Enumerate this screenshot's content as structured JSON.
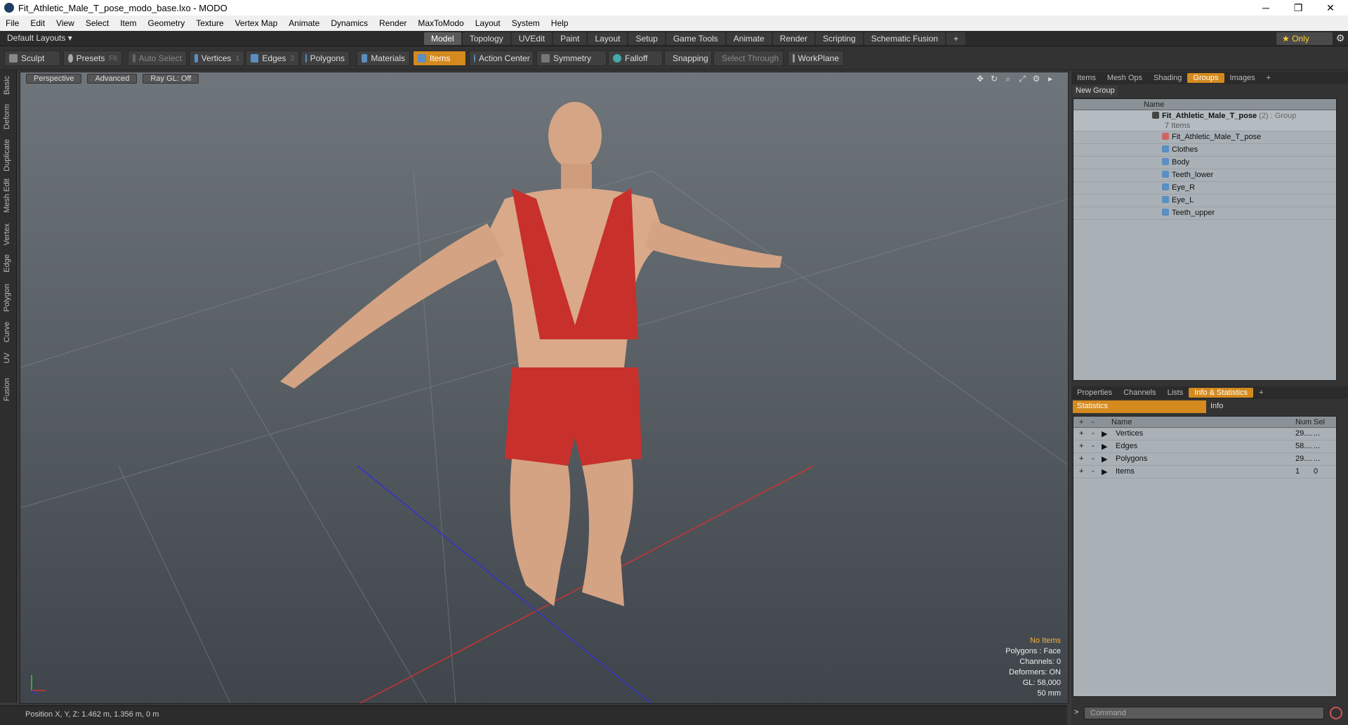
{
  "window": {
    "title": "Fit_Athletic_Male_T_pose_modo_base.lxo - MODO",
    "min": "─",
    "max": "❐",
    "close": "✕"
  },
  "menu": [
    "File",
    "Edit",
    "View",
    "Select",
    "Item",
    "Geometry",
    "Texture",
    "Vertex Map",
    "Animate",
    "Dynamics",
    "Render",
    "MaxToModo",
    "Layout",
    "System",
    "Help"
  ],
  "layouts_label": "Default Layouts ▾",
  "mode_tabs": [
    "Model",
    "Topology",
    "UVEdit",
    "Paint",
    "Layout",
    "Setup",
    "Game Tools",
    "Animate",
    "Render",
    "Scripting",
    "Schematic Fusion"
  ],
  "active_mode": "Model",
  "only_label": "★ Only",
  "toolbar": {
    "sculpt": "Sculpt",
    "presets": "Presets",
    "presets_hk": "F6",
    "auto_select": "Auto Select",
    "vertices": "Vertices",
    "vertices_hk": "1",
    "edges": "Edges",
    "edges_hk": "2",
    "polygons": "Polygons",
    "materials": "Materials",
    "items": "Items",
    "action_center": "Action Center",
    "symmetry": "Symmetry",
    "falloff": "Falloff",
    "snapping": "Snapping",
    "select_through": "Select Through",
    "workplane": "WorkPlane"
  },
  "left_tabs": [
    "Basic",
    "Deform",
    "Duplicate",
    "Mesh Edit",
    "Vertex",
    "Edge",
    "Polygon",
    "Curve",
    "UV",
    "Fusion"
  ],
  "viewport": {
    "perspective": "Perspective",
    "advanced": "Advanced",
    "raygl": "Ray GL: Off",
    "info": {
      "no_items": "No Items",
      "polygons": "Polygons : Face",
      "channels": "Channels: 0",
      "deformers": "Deformers: ON",
      "gl": "GL: 58,000",
      "scale": "50 mm"
    }
  },
  "status": {
    "position": "Position X, Y, Z:   1.462 m, 1.356 m, 0 m"
  },
  "top_panel_tabs": [
    "Items",
    "Mesh Ops",
    "Shading",
    "Groups",
    "Images"
  ],
  "top_active": "Groups",
  "new_group": "New Group",
  "tree": {
    "header_name": "Name",
    "group": {
      "name": "Fit_Athletic_Male_T_pose",
      "count": "(2)",
      "type": ": Group",
      "sub": "7 Items"
    },
    "children": [
      "Fit_Athletic_Male_T_pose",
      "Clothes",
      "Body",
      "Teeth_lower",
      "Eye_R",
      "Eye_L",
      "Teeth_upper"
    ]
  },
  "bottom_panel_tabs": [
    "Properties",
    "Channels",
    "Lists",
    "Info & Statistics"
  ],
  "bottom_active": "Info & Statistics",
  "stats_tabs": {
    "statistics": "Statistics",
    "info": "Info"
  },
  "stats": {
    "headers": {
      "plus": "+",
      "minus": "-",
      "name": "Name",
      "num": "Num",
      "sel": "Sel"
    },
    "rows": [
      {
        "name": "Vertices",
        "num": "29....",
        "sel": "..."
      },
      {
        "name": "Edges",
        "num": "58....",
        "sel": "..."
      },
      {
        "name": "Polygons",
        "num": "29....",
        "sel": "..."
      },
      {
        "name": "Items",
        "num": "1",
        "sel": "0"
      }
    ]
  },
  "command": {
    "prompt": ">",
    "placeholder": "Command"
  },
  "colors": {
    "accent": "#d48a1e",
    "viewport_top": "#6e757b",
    "viewport_bottom": "#3f454a"
  }
}
